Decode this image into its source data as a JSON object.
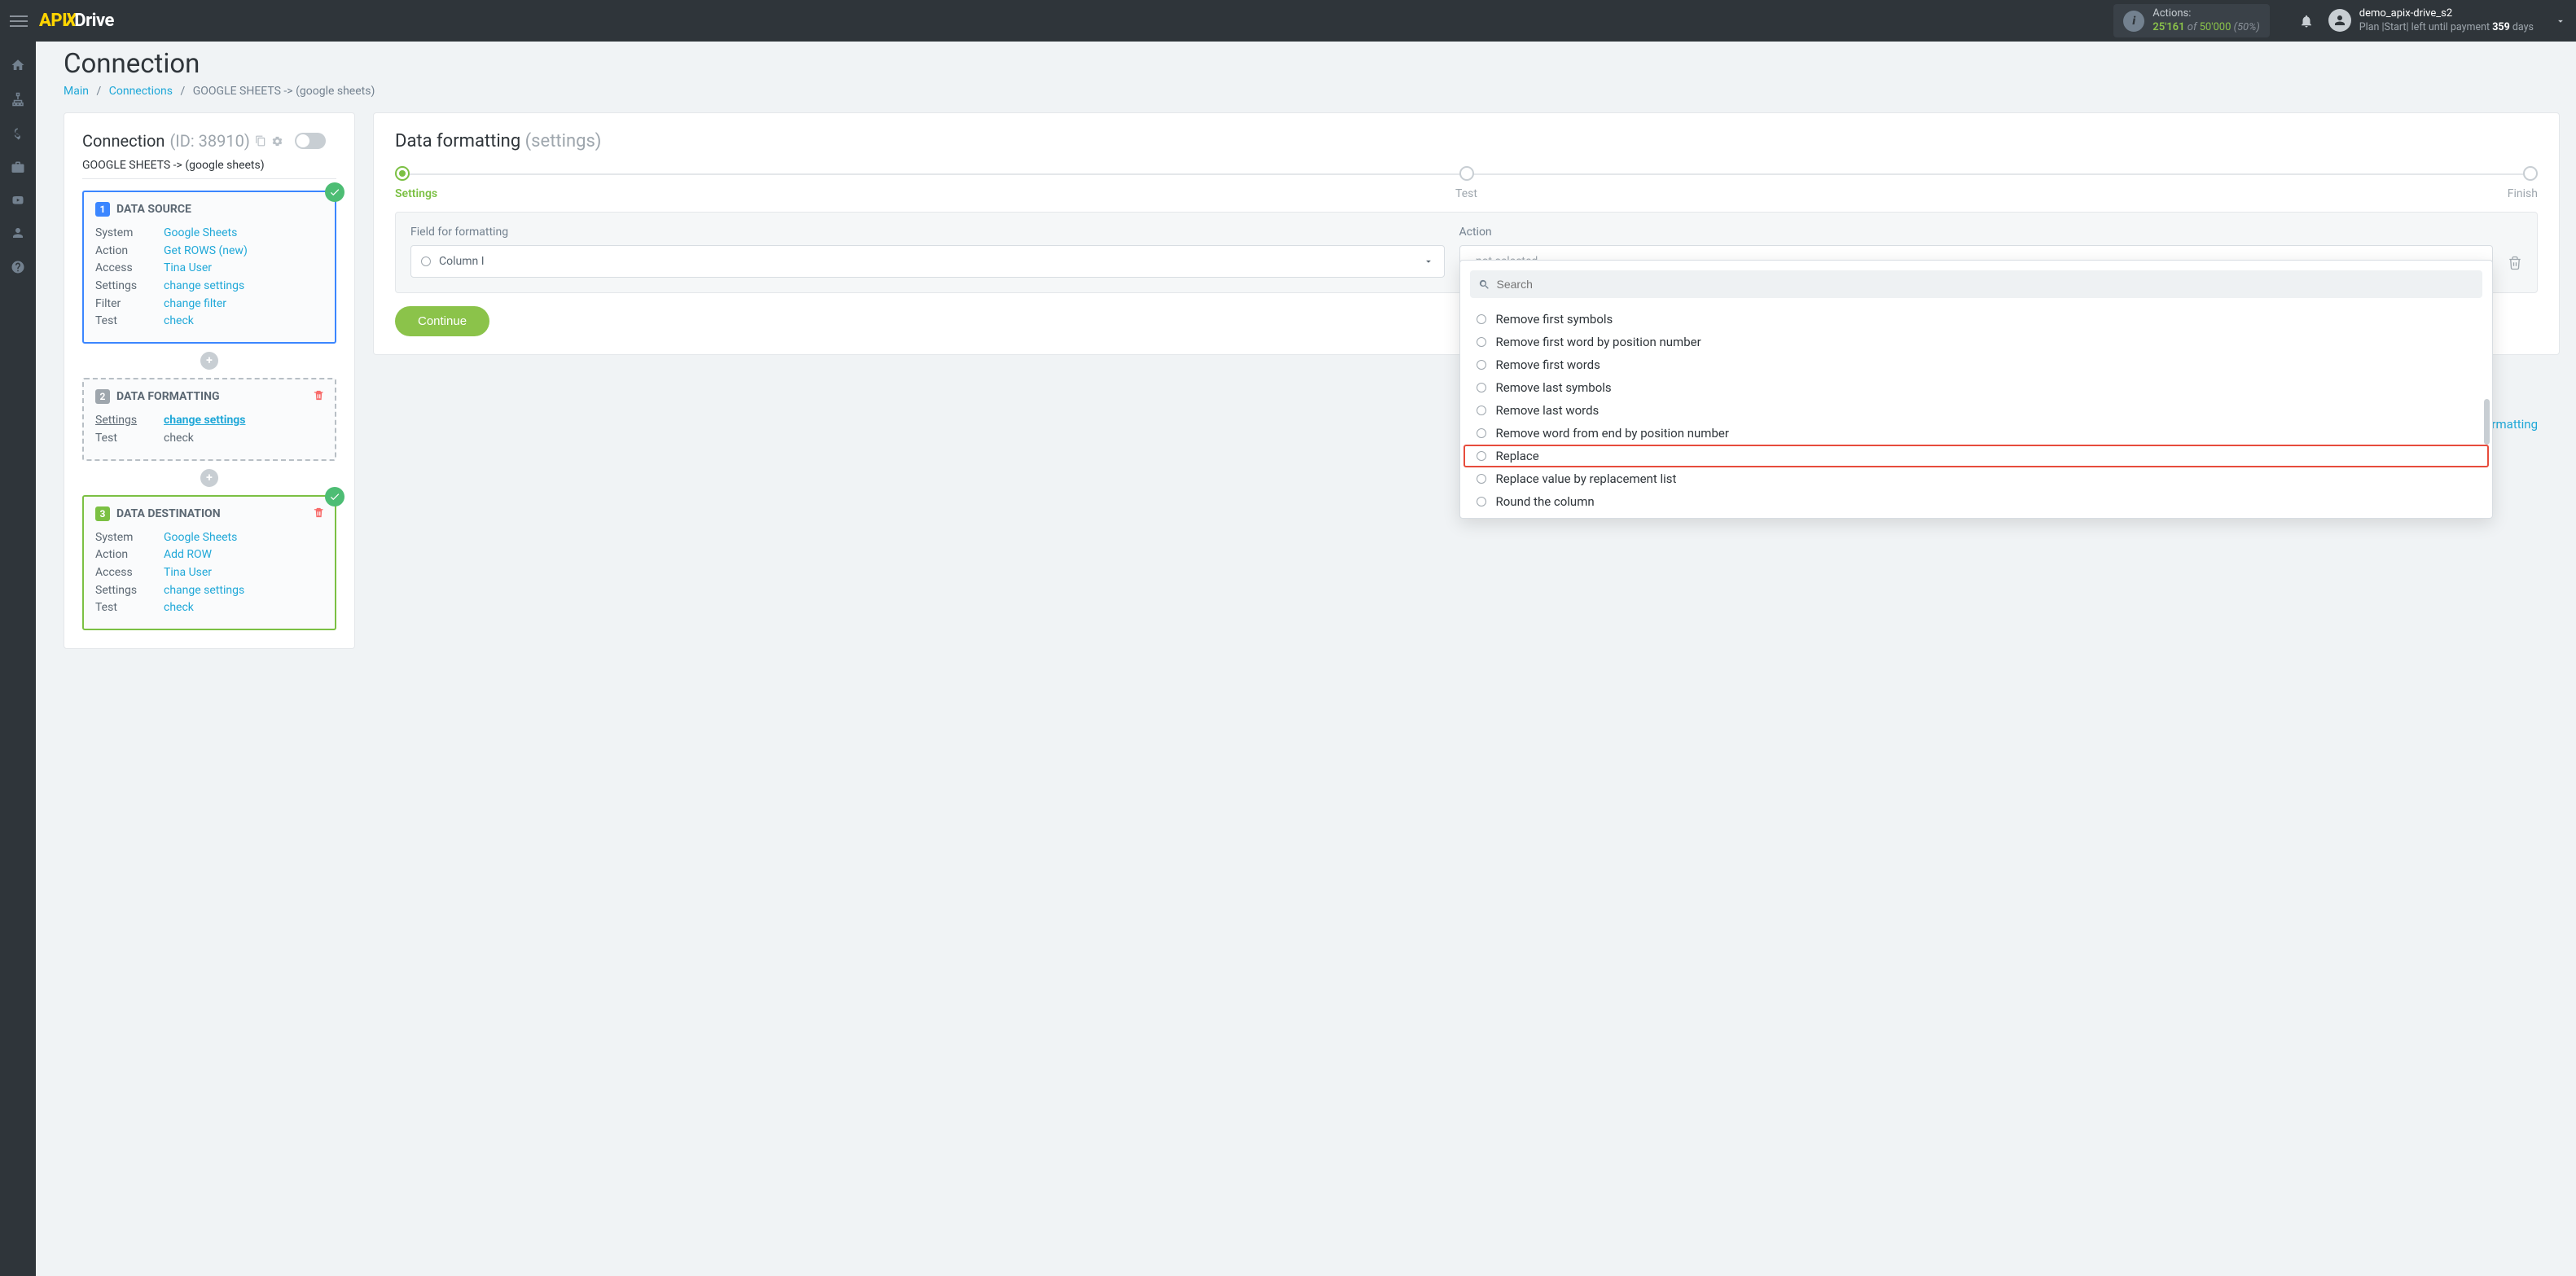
{
  "topbar": {
    "logo_api": "API",
    "logo_x": "X",
    "logo_drive": "Drive",
    "actions_label": "Actions:",
    "actions_used": "25'161",
    "actions_of": "of",
    "actions_total": "50'000",
    "actions_pct": "(50%)",
    "username": "demo_apix-drive_s2",
    "plan_prefix": "Plan ",
    "plan_name": "|Start|",
    "plan_left": " left until payment ",
    "plan_days": "359",
    "plan_days_suffix": " days"
  },
  "page": {
    "title": "Connection",
    "breadcrumb": {
      "main": "Main",
      "connections": "Connections",
      "current": "GOOGLE SHEETS -> (google sheets)"
    }
  },
  "left": {
    "conn_title": "Connection",
    "conn_id": "(ID: 38910)",
    "conn_sub": "GOOGLE SHEETS -> (google sheets)",
    "source": {
      "title": "DATA SOURCE",
      "num": "1",
      "rows": [
        {
          "k": "System",
          "v": "Google Sheets"
        },
        {
          "k": "Action",
          "v": "Get ROWS (new)"
        },
        {
          "k": "Access",
          "v": "Tina User"
        },
        {
          "k": "Settings",
          "v": "change settings"
        },
        {
          "k": "Filter",
          "v": "change filter"
        },
        {
          "k": "Test",
          "v": "check"
        }
      ]
    },
    "formatting": {
      "title": "DATA FORMATTING",
      "num": "2",
      "rows": [
        {
          "k": "Settings",
          "v": "change settings",
          "bold": true
        },
        {
          "k": "Test",
          "v": "check",
          "plain": true
        }
      ]
    },
    "destination": {
      "title": "DATA DESTINATION",
      "num": "3",
      "rows": [
        {
          "k": "System",
          "v": "Google Sheets"
        },
        {
          "k": "Action",
          "v": "Add ROW"
        },
        {
          "k": "Access",
          "v": "Tina User"
        },
        {
          "k": "Settings",
          "v": "change settings"
        },
        {
          "k": "Test",
          "v": "check"
        }
      ]
    },
    "plus": "+"
  },
  "right": {
    "title_main": "Data formatting",
    "title_sub": "(settings)",
    "steps": [
      "Settings",
      "Test",
      "Finish"
    ],
    "field_label": "Field for formatting",
    "field_value": "Column I",
    "action_label": "Action",
    "action_placeholder": "- not selected -",
    "continue": "Continue",
    "add_formatting_suffix": "ormatting",
    "dropdown": {
      "search_placeholder": "Search",
      "items": [
        "Remove first symbols",
        "Remove first word by position number",
        "Remove first words",
        "Remove last symbols",
        "Remove last words",
        "Remove word from end by position number",
        "Replace",
        "Replace value by replacement list",
        "Round the column"
      ],
      "highlight_index": 6
    }
  }
}
